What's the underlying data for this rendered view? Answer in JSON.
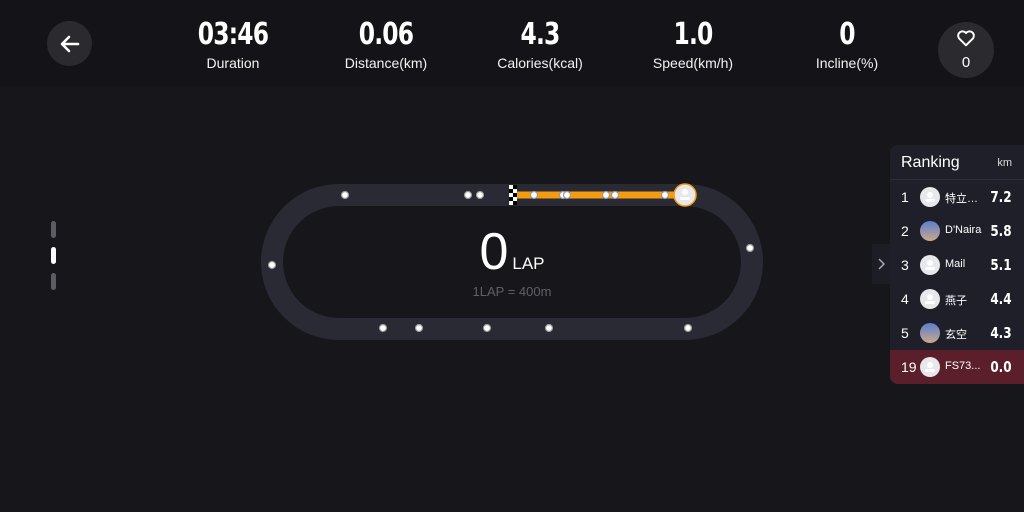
{
  "header": {
    "stats": [
      {
        "value": "03:46",
        "label": "Duration"
      },
      {
        "value": "0.06",
        "label": "Distance(km)"
      },
      {
        "value": "4.3",
        "label": "Calories(kcal)"
      },
      {
        "value": "1.0",
        "label": "Speed(km/h)"
      },
      {
        "value": "0",
        "label": "Incline(%)"
      }
    ],
    "heart_rate": "0"
  },
  "track": {
    "laps": "0",
    "lap_unit": "LAP",
    "lap_info": "1LAP = 400m",
    "progress_fraction": 0.15,
    "colors": {
      "progress": "#f39c12",
      "track": "#2a2a35"
    }
  },
  "ranking": {
    "title": "Ranking",
    "unit": "km",
    "rows": [
      {
        "rank": "1",
        "name": "特立…",
        "km": "7.2",
        "avatar": "default"
      },
      {
        "rank": "2",
        "name": "D'Naira",
        "km": "5.8",
        "avatar": "photo"
      },
      {
        "rank": "3",
        "name": "Mail",
        "km": "5.1",
        "avatar": "default"
      },
      {
        "rank": "4",
        "name": "燕子",
        "km": "4.4",
        "avatar": "default"
      },
      {
        "rank": "5",
        "name": "玄空",
        "km": "4.3",
        "avatar": "photo"
      },
      {
        "rank": "19",
        "name": "FS73...",
        "km": "0.0",
        "avatar": "default",
        "is_me": true
      }
    ],
    "me_color": "#5b1f2b"
  },
  "icons": {
    "back": "arrow-left-icon",
    "heart": "heart-icon",
    "expand": "chevron-right-icon"
  }
}
